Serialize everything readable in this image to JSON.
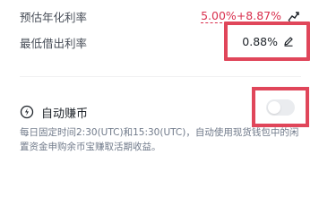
{
  "apy": {
    "label": "预估年化利率",
    "base": "5.00%",
    "bonus": "+8.87%",
    "icon": "chart-boost-icon",
    "color": "#d9304e"
  },
  "min_borrow_rate": {
    "label": "最低借出利率",
    "value": "0.88%",
    "edit_icon": "pencil-icon"
  },
  "auto_earn": {
    "icon": "auto-sync-icon",
    "title": "自动赚币",
    "toggle_state": "off",
    "description": "每日固定时间2:30(UTC)和15:30(UTC)，自动使用现货钱包中的闲置资金申购余币宝赚取活期收益。"
  },
  "highlight_color": "#e0465a"
}
